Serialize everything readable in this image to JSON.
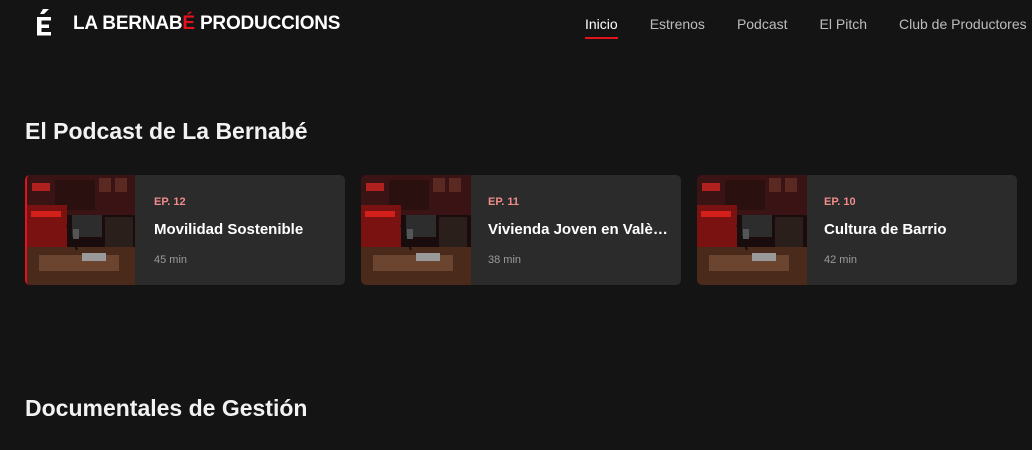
{
  "brand": {
    "name_part1": "LA BERNAB",
    "name_accent": "É",
    "name_part2": " PRODUCCIONS",
    "accent_color": "#e3131d"
  },
  "nav": {
    "items": [
      {
        "label": "Inicio",
        "active": true
      },
      {
        "label": "Estrenos",
        "active": false
      },
      {
        "label": "Podcast",
        "active": false
      },
      {
        "label": "El Pitch",
        "active": false
      },
      {
        "label": "Club de Productores",
        "active": false
      }
    ]
  },
  "podcast_section": {
    "title": "El Podcast de La Bernabé",
    "episodes": [
      {
        "episode": "EP. 12",
        "title": "Movilidad Sostenible",
        "duration": "45 min",
        "thumbnail_icon": "podcast-studio-image"
      },
      {
        "episode": "EP. 11",
        "title": "Vivienda Joven en València",
        "duration": "38 min",
        "thumbnail_icon": "podcast-studio-image"
      },
      {
        "episode": "EP. 10",
        "title": "Cultura de Barrio",
        "duration": "42 min",
        "thumbnail_icon": "podcast-studio-image"
      }
    ]
  },
  "docs_section": {
    "title": "Documentales de Gestión"
  }
}
